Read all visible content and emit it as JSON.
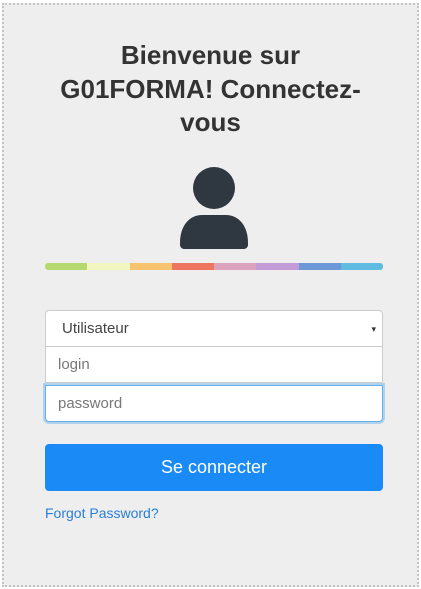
{
  "login_card": {
    "title": "Bienvenue sur G01FORMA! Connectez-vous",
    "avatar_icon": "user-icon",
    "color_bar": [
      "#b6d96f",
      "#f2f7c1",
      "#f7c36e",
      "#ee7560",
      "#dca3bf",
      "#c39bd6",
      "#6c98d8",
      "#5fbbdf"
    ],
    "role_select": {
      "selected": "Utilisateur",
      "arrow": "▾"
    },
    "login_input": {
      "placeholder": "login",
      "value": ""
    },
    "password_input": {
      "placeholder": "password",
      "value": ""
    },
    "submit_label": "Se connecter",
    "forgot_label": "Forgot Password?"
  }
}
